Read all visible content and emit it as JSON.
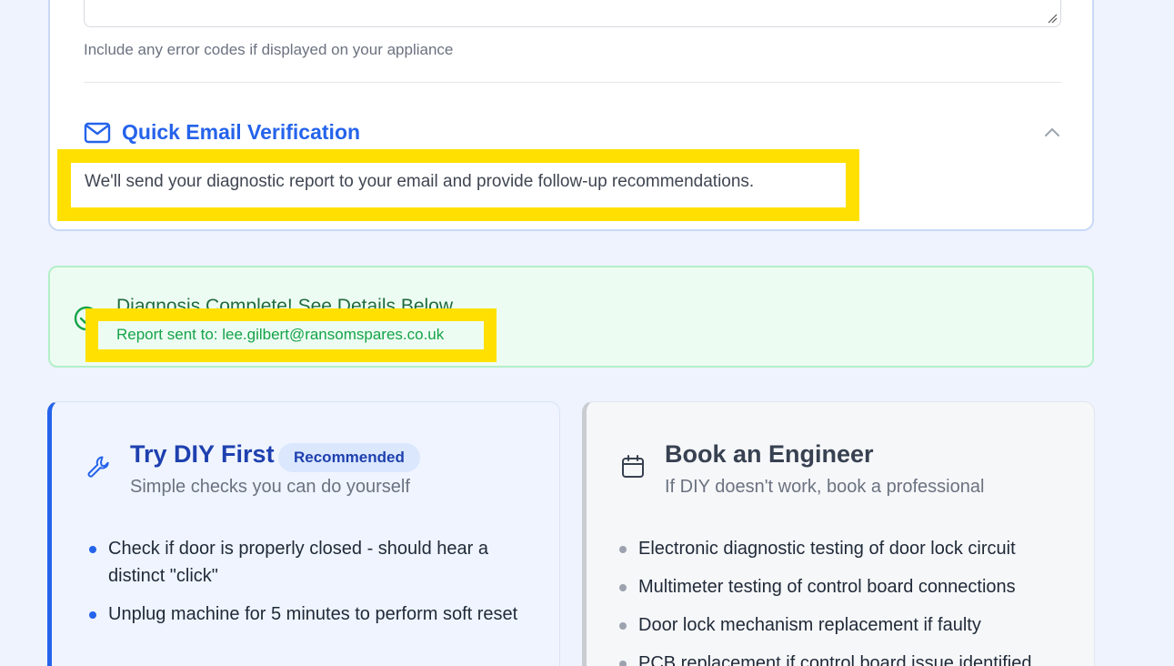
{
  "form": {
    "helper_text": "Include any error codes if displayed on your appliance",
    "email_section": {
      "title": "Quick Email Verification",
      "icon": "mail-icon",
      "toggle_icon": "chevron-up-icon",
      "description": "We'll send your diagnostic report to your email and provide follow-up recommendations."
    }
  },
  "status": {
    "title": "Diagnosis Complete! See Details Below",
    "icon": "check-circle-icon",
    "report_sent": "Report sent to: lee.gilbert@ransomspares.co.uk"
  },
  "diy": {
    "title": "Try DIY First",
    "badge": "Recommended",
    "subtitle": "Simple checks you can do yourself",
    "icon": "wrench-icon",
    "steps": [
      "Check if door is properly closed - should hear a distinct \"click\"",
      "Unplug machine for 5 minutes to perform soft reset"
    ]
  },
  "engineer": {
    "title": "Book an Engineer",
    "subtitle": "If DIY doesn't work, book a professional",
    "icon": "calendar-icon",
    "services": [
      "Electronic diagnostic testing of door lock circuit",
      "Multimeter testing of control board connections",
      "Door lock mechanism replacement if faulty",
      "PCB replacement if control board issue identified"
    ]
  },
  "colors": {
    "accent": "#2563eb",
    "highlight": "#ffe000",
    "success": "#16a34a"
  }
}
